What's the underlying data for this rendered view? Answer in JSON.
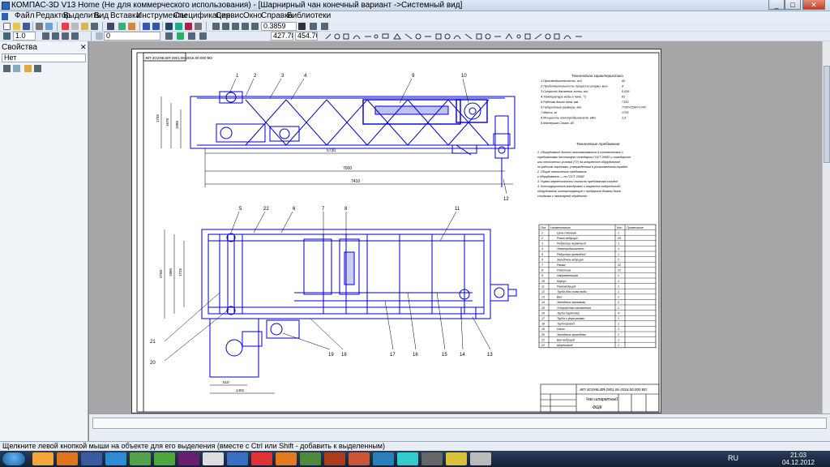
{
  "window": {
    "title": "КОМПАС-3D V13 Home (Не для коммерческого использования) - [Шарнирный чан  конечный вариант ->Системный вид]",
    "buttons": {
      "minimize": "_",
      "maximize": "□",
      "close": "✕"
    }
  },
  "menu": [
    "Файл",
    "Редактор",
    "Выделить",
    "Вид",
    "Вставка",
    "Инструменты",
    "Спецификация",
    "Сервис",
    "Окно",
    "Справка",
    "Библиотеки"
  ],
  "toolbar1": {
    "zoom": "0.3859"
  },
  "toolbar2": {
    "step": "1.0",
    "layer": "0",
    "coord_x": "427.78",
    "coord_y": "454.70"
  },
  "panel": {
    "title": "Свойства",
    "select_value": "Нет",
    "close_glyph": "✕"
  },
  "drawing": {
    "stamp": "ЖП-3ОЗНБ.ВЯ-2901.06-2016.00.000 ВО",
    "stamp_title": "Чан шпаратный",
    "stamp_code": "ФЩК",
    "tech_title": "Техническая характеристика",
    "tech_lines": [
      "1.Производительность, т/ч",
      "2.Продолжительность процесса шпарки, мин",
      "3.Скорость движения линии, м/с",
      "4.Температура воды в чане, °С",
      "5.Рабочая длина чана, мм",
      "6.Габаритные размеры, мм",
      "7.Масса, кг",
      "8.Мощность электродвигателя, кВт",
      "9.Материал   Сталь 45"
    ],
    "tech_values": [
      "60",
      "4",
      "0,026",
      "62",
      "7100",
      "7730×1560×1740",
      "1700",
      "1,5",
      ""
    ],
    "req_title": "Технические требования",
    "req_lines": [
      "1. Оборудование должно изготавливаться в соответствии с",
      "требованиями настоящего стандарта ГОСТ 26582 и стандартов",
      "или технических условий (ТУ) на конкретное оборудование",
      "по рабочим чертежам, утвержденным в установленном порядке.",
      "2. Общие технические требования",
      "к оборудованию — по ГОСТ 26582.",
      "3. Нормы герметичности согласно требованиям сосудов.",
      "4. Конструкционные материалы и покрытия поверхностей",
      "оборудования, контактирующие с продуктом должны быть",
      "стойкими к санитарной обработке."
    ],
    "spec_headers": [
      "Поз.",
      "Наименование",
      "Кол.",
      "Примечание"
    ],
    "spec_rows": [
      [
        "1",
        "Цепь тяговая",
        "1"
      ],
      [
        "2",
        "Ролик ведущий",
        "20"
      ],
      [
        "3",
        "Редуктор червячный",
        "1"
      ],
      [
        "4",
        "Электродвигатель",
        "1"
      ],
      [
        "5",
        "Редуктор приводной",
        "1"
      ],
      [
        "6",
        "Звездочка ведущая",
        "2"
      ],
      [
        "7",
        "Рамка",
        "22"
      ],
      [
        "8",
        "Пластина",
        "22"
      ],
      [
        "9",
        "Направляющая",
        "2"
      ],
      [
        "10",
        "Корпус",
        "1"
      ],
      [
        "11",
        "Рамоведущая",
        "1"
      ],
      [
        "12",
        "Труба для слива воды",
        "1"
      ],
      [
        "13",
        "Вал",
        "1"
      ],
      [
        "14",
        "Звездочка натяжная",
        "2"
      ],
      [
        "15",
        "Устройство натяжения",
        "2"
      ],
      [
        "16",
        "Труба барботёр",
        "4"
      ],
      [
        "17",
        "Труба с форсунками",
        "1"
      ],
      [
        "18",
        "Трубопровод",
        "1"
      ],
      [
        "19",
        "Насос",
        "1"
      ],
      [
        "20",
        "Звездочка приводная",
        "2"
      ],
      [
        "21",
        "Вал ведущий",
        "1"
      ],
      [
        "22",
        "Шпрековый",
        "1"
      ]
    ],
    "dims_top": [
      "5730",
      "7000",
      "7410",
      "1745",
      "1676",
      "1086"
    ],
    "dims_bottom": [
      "2760",
      "1860",
      "1726",
      "610",
      "1402"
    ],
    "balloons_top": [
      "1",
      "2",
      "3",
      "4",
      "9",
      "10",
      "12"
    ],
    "balloons_bottom": [
      "5",
      "22",
      "6",
      "7",
      "8",
      "11",
      "21",
      "20",
      "19",
      "18",
      "17",
      "16",
      "15",
      "14",
      "13"
    ]
  },
  "status": "Щелкните левой кнопкой мыши на объекте для его выделения (вместе с Ctrl или Shift - добавить к выделенным)",
  "taskbar": {
    "lang": "RU",
    "time": "21:03",
    "date": "04.12.2012"
  },
  "colors": {
    "drawing_blue": "#0000cc",
    "sheet_bg": "#ffffff",
    "workspace_bg": "#a7a7a7"
  }
}
